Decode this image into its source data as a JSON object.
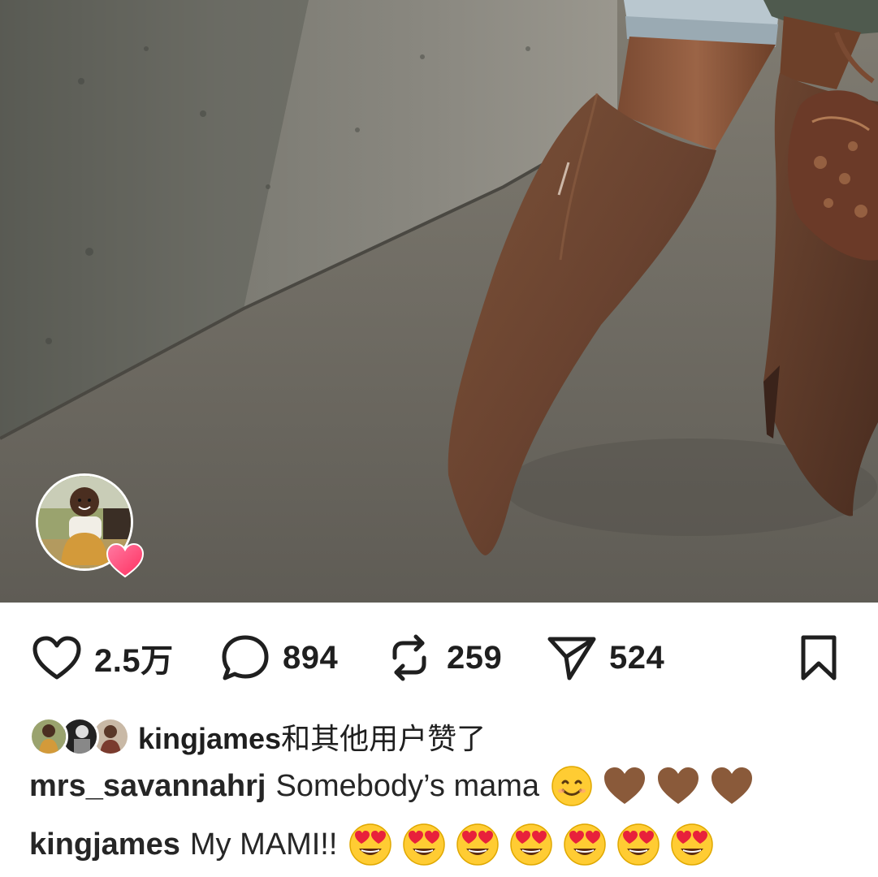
{
  "post": {
    "photo_description_icon": "boots-photo",
    "story_avatar_icon": "baby-avatar",
    "story_heart_icon": "heart-icon"
  },
  "actions": {
    "like": {
      "icon": "heart-outline-icon",
      "count": "2.5万"
    },
    "comment": {
      "icon": "comment-bubble-icon",
      "count": "894"
    },
    "repost": {
      "icon": "repost-icon",
      "count": "259"
    },
    "share": {
      "icon": "paper-plane-icon",
      "count": "524"
    },
    "save": {
      "icon": "bookmark-icon"
    }
  },
  "likes": {
    "username": "kingjames",
    "suffix": "和其他用户赞了"
  },
  "comments": [
    {
      "username": "mrs_savannahrj",
      "text": "Somebody’s mama",
      "emojis": [
        "smiling-face",
        "brown-heart",
        "brown-heart",
        "brown-heart"
      ]
    },
    {
      "username": "kingjames",
      "text": "My MAMI!!",
      "emojis": [
        "heart-eyes",
        "heart-eyes",
        "heart-eyes",
        "heart-eyes",
        "heart-eyes",
        "heart-eyes",
        "heart-eyes"
      ]
    }
  ],
  "colors": {
    "text": "#262626",
    "boot": "#6b4530",
    "concrete": "#6f6c63",
    "brown_heart": "#8a5a3a",
    "heart_badge": "#ff4d7a"
  }
}
